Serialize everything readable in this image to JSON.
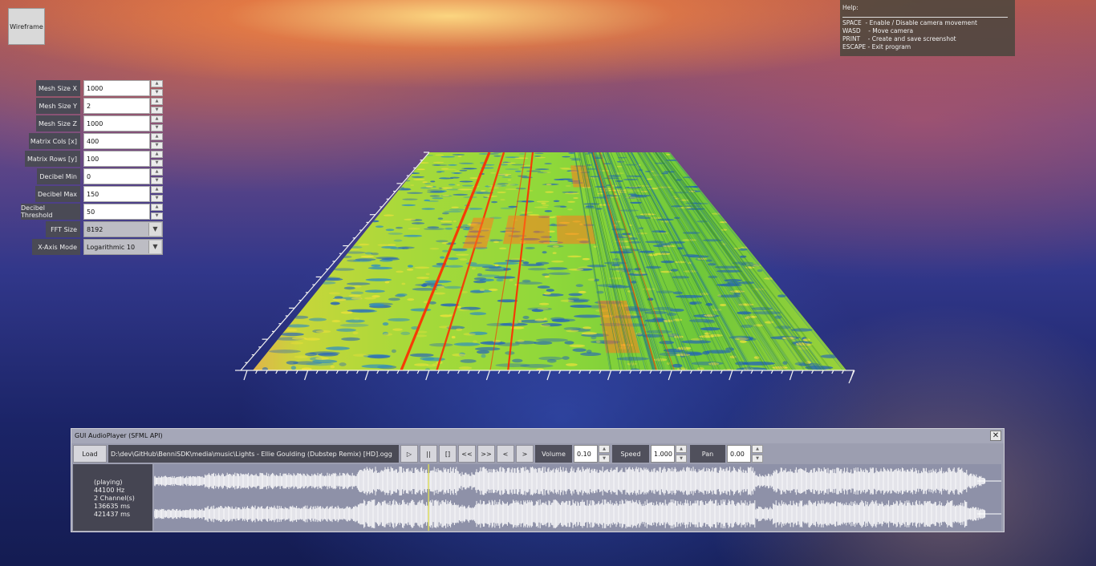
{
  "wireframe_button": {
    "label": "Wireframe"
  },
  "help": {
    "title": "Help:",
    "rows": [
      "SPACE  - Enable / Disable camera movement",
      "WASD    - Move camera",
      "PRINT    - Create and save screenshot",
      "ESCAPE - Exit program"
    ]
  },
  "settings": [
    {
      "label": "Mesh Size X",
      "value": "1000"
    },
    {
      "label": "Mesh Size Y",
      "value": "2"
    },
    {
      "label": "Mesh Size Z",
      "value": "1000"
    },
    {
      "label": "Matrix Cols [x]",
      "value": "400"
    },
    {
      "label": "Matrix Rows [y]",
      "value": "100"
    },
    {
      "label": "Decibel Min",
      "value": "0"
    },
    {
      "label": "Decibel Max",
      "value": "150"
    },
    {
      "label": "Decibel Threshold",
      "value": "50"
    }
  ],
  "selects": [
    {
      "label": "FFT Size",
      "value": "8192"
    },
    {
      "label": "X-Axis Mode",
      "value": "Logarithmic 10"
    }
  ],
  "player": {
    "title": "GUI AudioPlayer (SFML API)",
    "close_glyph": "✕",
    "load_label": "Load",
    "file_path": "D:\\dev\\GitHub\\BenniSDK\\media\\music\\Lights - Ellie Goulding (Dubstep Remix) [HD].ogg",
    "transport": {
      "play": "▷",
      "pause": "||",
      "stop": "[]",
      "rewind": "<<",
      "forward": ">>",
      "prev": "<",
      "next": ">"
    },
    "volume": {
      "label": "Volume",
      "value": "0.10"
    },
    "speed": {
      "label": "Speed",
      "value": "1.000"
    },
    "pan": {
      "label": "Pan",
      "value": "0.00"
    },
    "info": {
      "status": "(playing)",
      "sample_rate": "44100 Hz",
      "channels": "2 Channel(s)",
      "position": "136635 ms",
      "duration": "421437 ms"
    },
    "playhead_fraction": 0.324
  },
  "colors": {
    "spectrum_low": "#1f5fbf",
    "spectrum_mid": "#7fd62a",
    "spectrum_high": "#ff2a00",
    "playhead": "#e8e84a"
  }
}
